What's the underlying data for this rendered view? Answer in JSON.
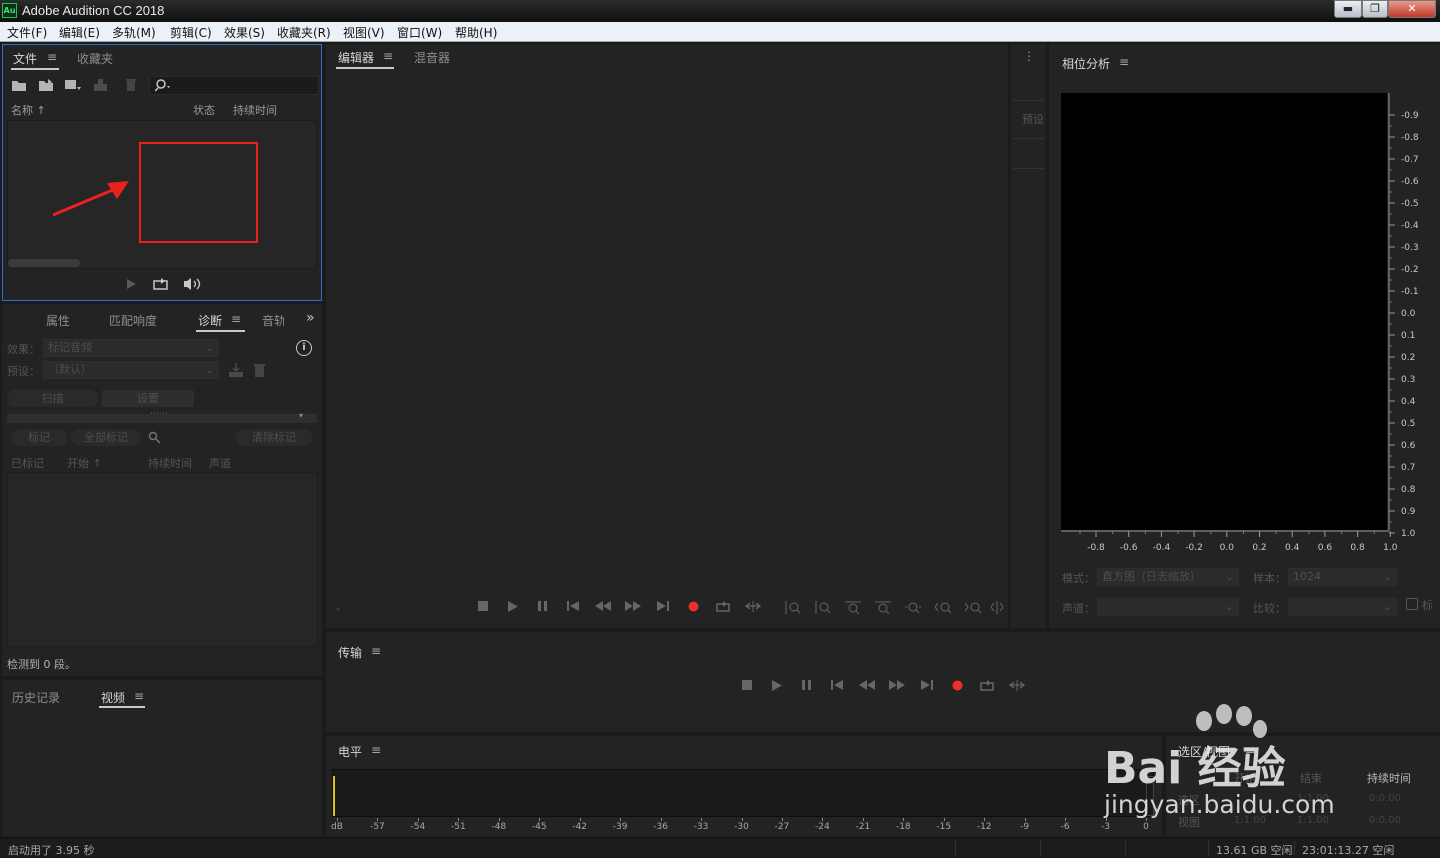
{
  "window": {
    "title": "Adobe Audition CC 2018",
    "logo_text": "Au",
    "minimize": "▬",
    "maximize": "❐",
    "close": "✕"
  },
  "menu": [
    "文件(F)",
    "编辑(E)",
    "多轨(M)",
    "剪辑(C)",
    "效果(S)",
    "收藏夹(R)",
    "视图(V)",
    "窗口(W)",
    "帮助(H)"
  ],
  "files_panel": {
    "tabs": [
      "文件",
      "收藏夹"
    ],
    "columns": [
      "名称 ↑",
      "状态",
      "持续时间"
    ],
    "search_placeholder": ""
  },
  "diagnostics_panel": {
    "tabs": [
      "属性",
      "匹配响度",
      "诊断",
      "音轨"
    ],
    "effect_label": "效果：",
    "effect_value": "标记音频",
    "preset_label": "预设：",
    "preset_value": "（默认）",
    "scan_button": "扫描",
    "settings_button": "设置",
    "mark_button": "标记",
    "mark_all_button": "全部标记",
    "clear_marks_button": "清除标记",
    "columns": [
      "已标记",
      "开始 ↑",
      "持续时间",
      "声道"
    ],
    "status": "检测到 0 段。"
  },
  "history_panel": {
    "tabs": [
      "历史记录",
      "视频"
    ]
  },
  "editor_panel": {
    "tabs": [
      "编辑器",
      "混音器"
    ],
    "presets_label": "预设"
  },
  "phase_panel": {
    "title": "相位分析",
    "right_ticks": [
      "-0.9",
      "-0.8",
      "-0.7",
      "-0.6",
      "-0.5",
      "-0.4",
      "-0.3",
      "-0.2",
      "-0.1",
      "0.0",
      "0.1",
      "0.2",
      "0.3",
      "0.4",
      "0.5",
      "0.6",
      "0.7",
      "0.8",
      "0.9",
      "1.0"
    ],
    "bottom_ticks": [
      "-0.8",
      "-0.6",
      "-0.4",
      "-0.2",
      "0.0",
      "0.2",
      "0.4",
      "0.6",
      "0.8",
      "1.0"
    ],
    "mode_label": "模式：",
    "mode_value": "直方图（日志缩放）",
    "samples_label": "样本：",
    "samples_value": "1024",
    "channel_label": "声道：",
    "compare_label": "比较：",
    "checkbox_label": "标"
  },
  "transport_panel": {
    "title": "传输"
  },
  "levels_panel": {
    "title": "电平",
    "scale": [
      "dB",
      "-57",
      "-54",
      "-51",
      "-48",
      "-45",
      "-42",
      "-39",
      "-36",
      "-33",
      "-30",
      "-27",
      "-24",
      "-21",
      "-18",
      "-15",
      "-12",
      "-9",
      "-6",
      "-3",
      "0"
    ]
  },
  "selection_panel": {
    "title": "选区/视图",
    "headers": [
      "开始",
      "结束",
      "持续时间"
    ],
    "rows": [
      {
        "label": "选区",
        "start": "",
        "end": "1:1.00",
        "dur": "0:0.00"
      },
      {
        "label": "视图",
        "start": "1:1.00",
        "end": "1:1.00",
        "dur": "0:0.00"
      }
    ]
  },
  "status_bar": {
    "left": "启动用了 3.95 秒",
    "disk": "13.61 GB 空闲",
    "time": "23:01:13.27 空闲"
  },
  "watermark": {
    "brand": "Bai 经验",
    "url": "jingyan.baidu.com"
  },
  "annotation_color": "#e8231c",
  "record_color": "#e8302c"
}
